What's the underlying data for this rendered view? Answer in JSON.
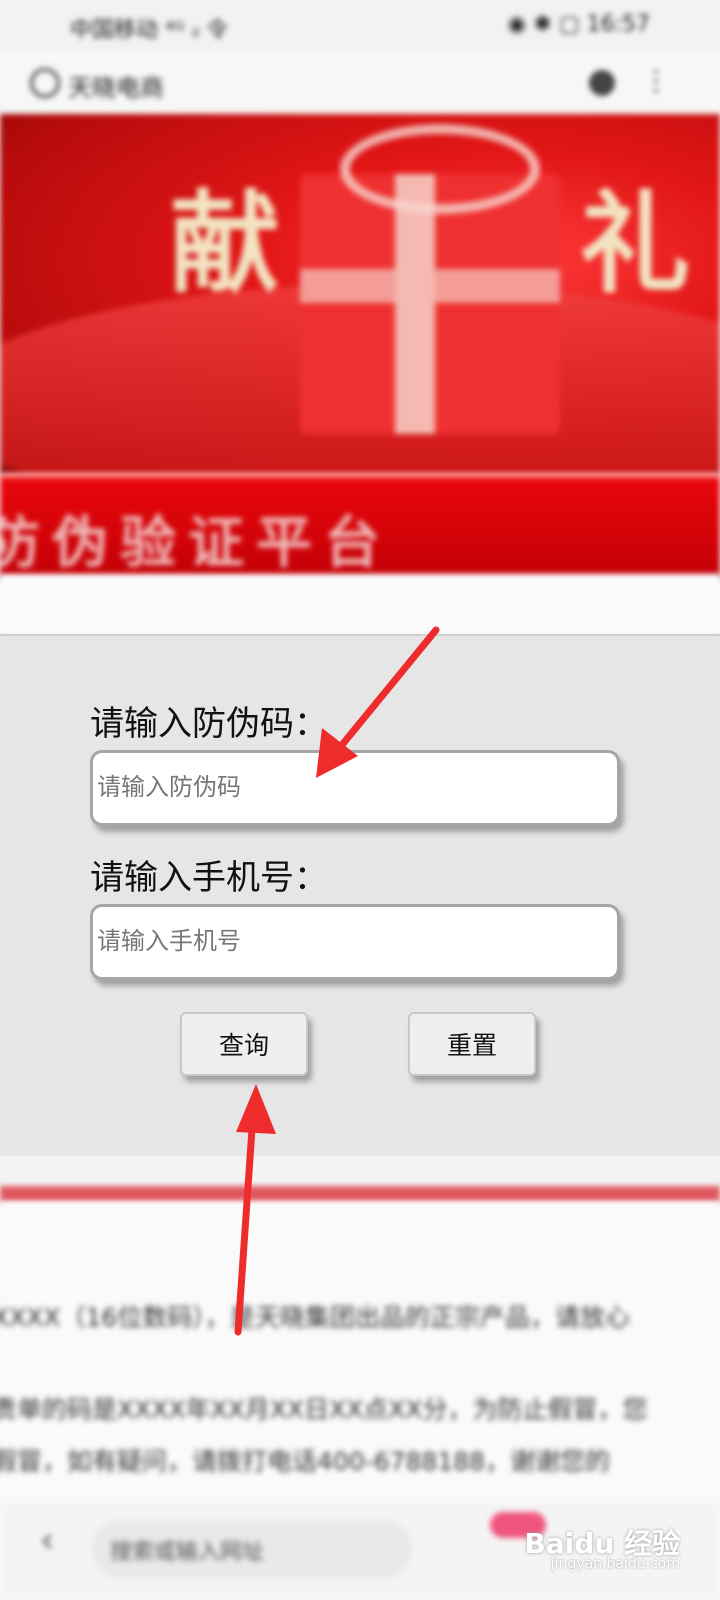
{
  "status_bar": {
    "left": "中国移动 ⁴ᴳ ᵢₗ 令",
    "right": "◉ ✱ ▢ 16:57"
  },
  "browser": {
    "title": "天晓电商",
    "more": "⋮"
  },
  "banner": {
    "char1": "献",
    "char2": "礼"
  },
  "band": {
    "title": "防伪验证平台"
  },
  "form": {
    "code_label": "请输入防伪码：",
    "code_placeholder": "请输入防伪码",
    "phone_label": "请输入手机号：",
    "phone_placeholder": "请输入手机号",
    "query_button": "查询",
    "reset_button": "重置"
  },
  "info": {
    "line1": "XXXX（16位数码），是天晓集团出品的正宗产品，请放心",
    "line2": "贵单的码是XXXX年XX月XX日XX点XX分，为防止假冒，您",
    "line3": "假冒，如有疑问，请拨打电话400-6788188，谢谢您的"
  },
  "bottom_nav": {
    "search_text": "搜索或输入网址",
    "back": "‹"
  },
  "watermark": {
    "brand": "Baidu 经验",
    "url": "jingyan.baidu.com"
  },
  "colors": {
    "accent_red": "#d3080b",
    "annotation_arrow": "#ee2c2c"
  }
}
